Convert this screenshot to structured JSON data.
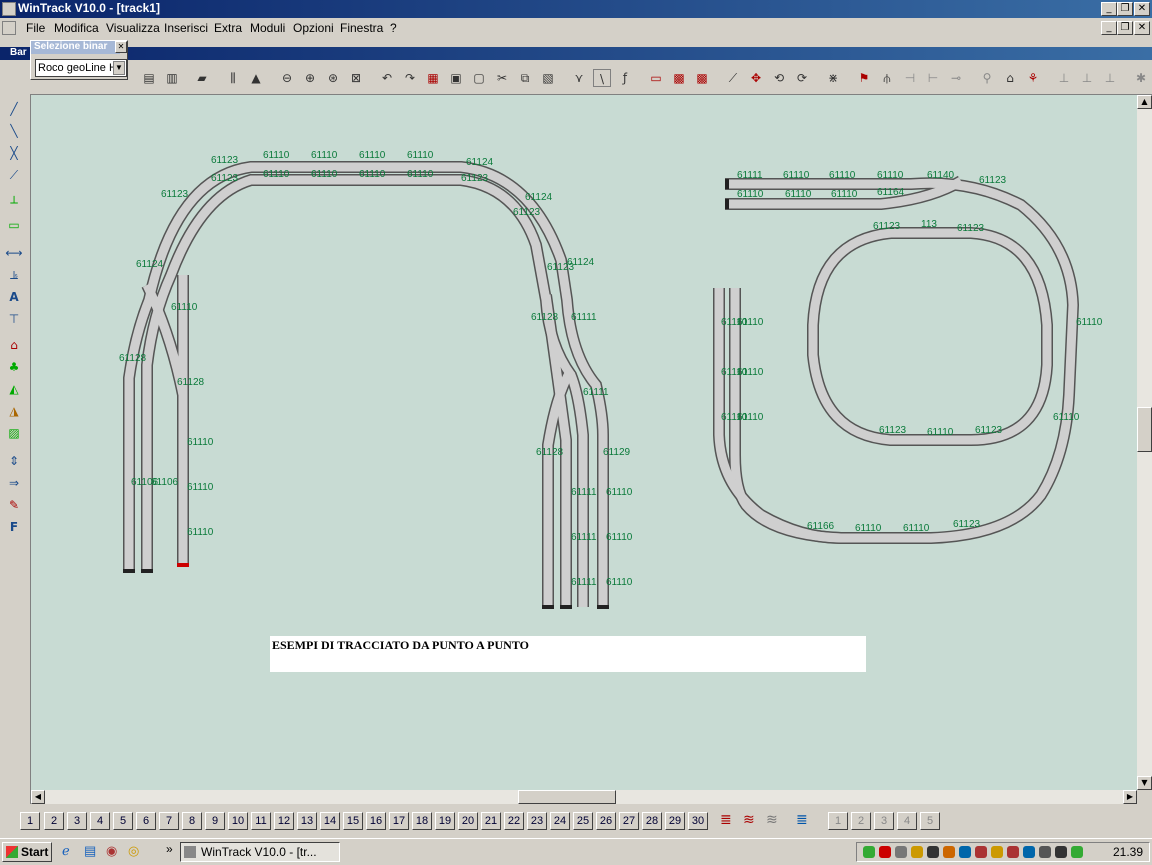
{
  "window": {
    "title": "WinTrack  V10.0 - [track1]"
  },
  "menu": [
    "File",
    "Modifica",
    "Visualizza",
    "Inserisci",
    "Extra",
    "Moduli",
    "Opzioni",
    "Finestra",
    "?"
  ],
  "doc_tab": {
    "label": "Bar"
  },
  "panel": {
    "title": "Selezione binar",
    "selected": "Roco geoLine H"
  },
  "canvas": {
    "note": "ESEMPI DI TRACCIATO DA PUNTO A PUNTO",
    "labels": {
      "a": "61110",
      "b": "61123",
      "c": "61124",
      "d": "61111",
      "e": "61128",
      "f": "61106",
      "g": "61140",
      "h": "113",
      "i": "61166",
      "j": "61129",
      "k": "61164"
    }
  },
  "pages": [
    "1",
    "2",
    "3",
    "4",
    "5",
    "6",
    "7",
    "8",
    "9",
    "10",
    "11",
    "12",
    "13",
    "14",
    "15",
    "16",
    "17",
    "18",
    "19",
    "20",
    "21",
    "22",
    "23",
    "24",
    "25",
    "26",
    "27",
    "28",
    "29",
    "30"
  ],
  "layer_buttons": [
    "1",
    "2",
    "3",
    "4",
    "5"
  ],
  "taskbar": {
    "start": "Start",
    "task": "WinTrack  V10.0 - [tr...",
    "clock": "21.39"
  }
}
